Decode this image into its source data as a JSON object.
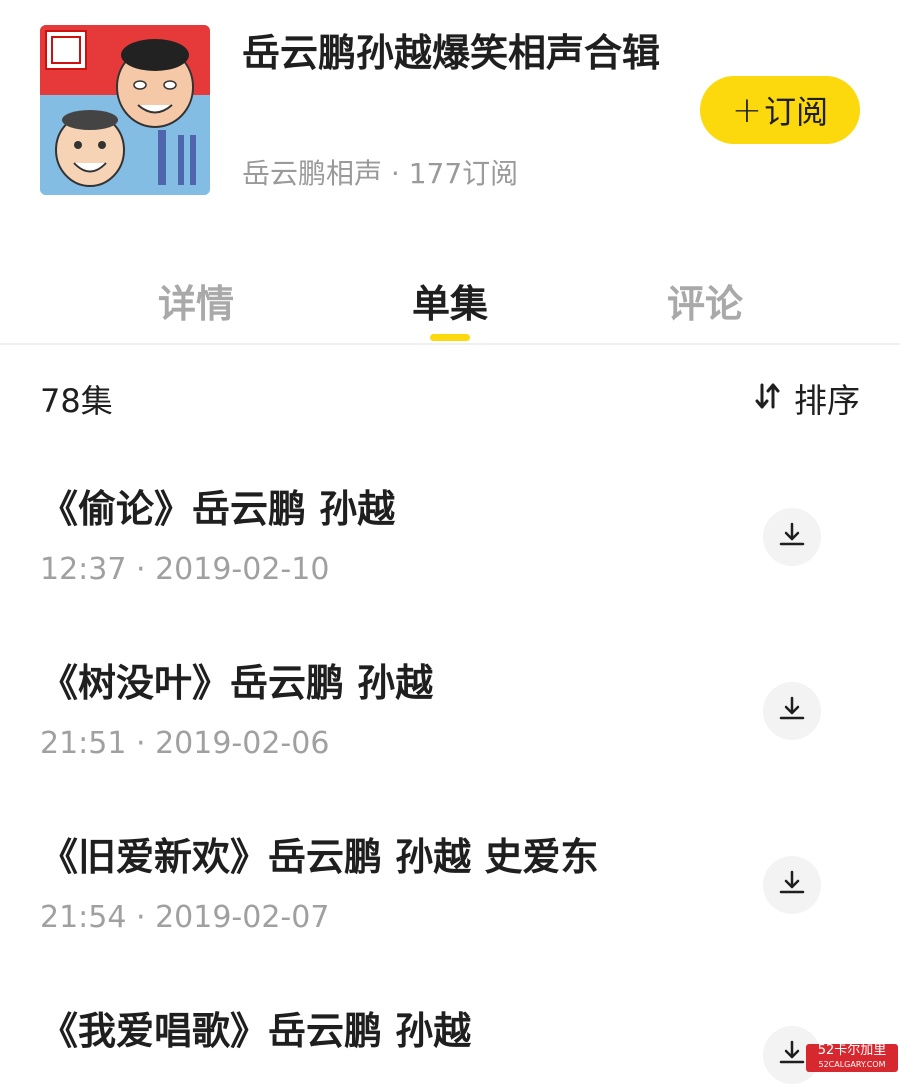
{
  "album": {
    "title": "岳云鹏孙越爆笑相声合辑",
    "author": "岳云鹏相声",
    "separator": " · ",
    "subscribers": "177订阅"
  },
  "subscribe_button": {
    "plus": "+",
    "label": "订阅"
  },
  "tabs": [
    {
      "label": "详情",
      "active": false
    },
    {
      "label": "单集",
      "active": true
    },
    {
      "label": "评论",
      "active": false
    }
  ],
  "list_header": {
    "episode_count": "78集",
    "sort_label": "排序"
  },
  "episodes": [
    {
      "title": "《偷论》岳云鹏 孙越",
      "duration": "12:37",
      "date": "2019-02-10"
    },
    {
      "title": "《树没叶》岳云鹏 孙越",
      "duration": "21:51",
      "date": "2019-02-06"
    },
    {
      "title": "《旧爱新欢》岳云鹏 孙越 史爱东",
      "duration": "21:54",
      "date": "2019-02-07"
    },
    {
      "title": "《我爱唱歌》岳云鹏 孙越",
      "duration": "",
      "date": ""
    }
  ],
  "watermark": {
    "main": "52卡尔加里",
    "sub": "52CALGARY.COM"
  },
  "colors": {
    "accent": "#fbd90c",
    "text": "#1f1f1f",
    "muted": "#a0a0a0"
  },
  "icons": [
    "download-icon",
    "sort-icon",
    "plus-icon"
  ]
}
